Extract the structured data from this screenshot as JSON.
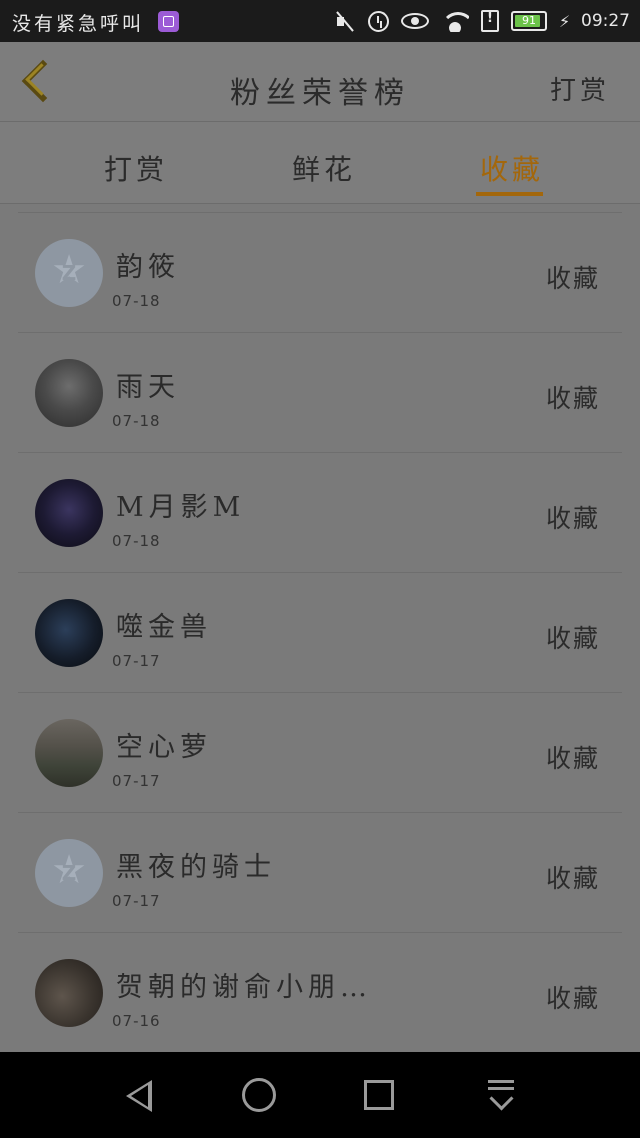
{
  "status_bar": {
    "carrier_text": "没有紧急呼叫",
    "battery_percent": 91,
    "battery_label": "91",
    "time": "09:27"
  },
  "header": {
    "title": "粉丝荣誉榜",
    "action_label": "打赏"
  },
  "tabs": [
    {
      "label": "打赏"
    },
    {
      "label": "鲜花"
    },
    {
      "label": "收藏"
    }
  ],
  "active_tab": "收藏",
  "list": {
    "items": [
      {
        "name": "韵筱",
        "date": "07-18",
        "action": "收藏",
        "avatar": "default-avatar"
      },
      {
        "name": "雨天",
        "date": "07-18",
        "action": "收藏",
        "avatar": "photo-avatar"
      },
      {
        "name": "M月影M",
        "date": "07-18",
        "action": "收藏",
        "avatar": "photo-avatar"
      },
      {
        "name": "噬金兽",
        "date": "07-17",
        "action": "收藏",
        "avatar": "photo-avatar"
      },
      {
        "name": "空心萝",
        "date": "07-17",
        "action": "收藏",
        "avatar": "photo-avatar"
      },
      {
        "name": "黑夜的骑士",
        "date": "07-17",
        "action": "收藏",
        "avatar": "default-avatar"
      },
      {
        "name": "贺朝的谢俞小朋…",
        "date": "07-16",
        "action": "收藏",
        "avatar": "photo-avatar"
      }
    ]
  },
  "colors": {
    "accent": "#a3670c",
    "overlay_background": "#7a7a7a",
    "status_bar": "#1b1b1b",
    "nav_bar": "#000000"
  }
}
